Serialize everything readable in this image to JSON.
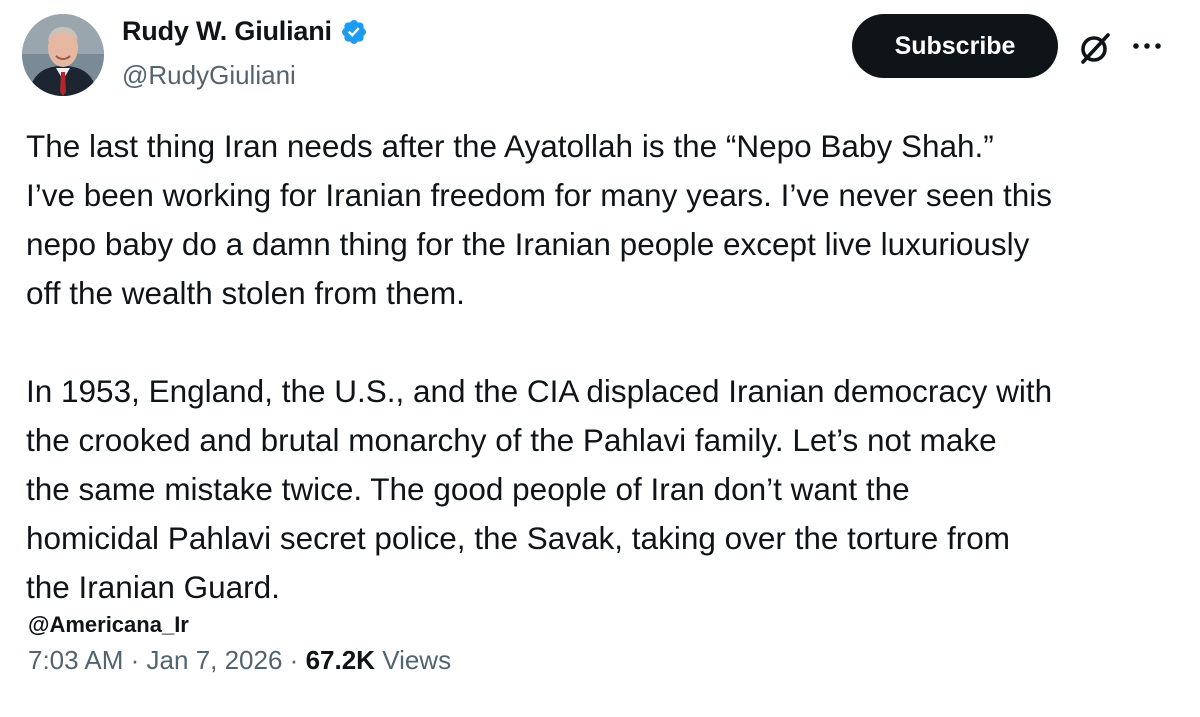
{
  "author": {
    "display_name": "Rudy W. Giuliani",
    "handle": "@RudyGiuliani",
    "avatar_icon": "profile-photo",
    "verified_icon": "verified-badge-icon",
    "verified_color": "#1d9bf0"
  },
  "actions": {
    "subscribe_label": "Subscribe",
    "grok_icon": "grok-icon",
    "more_icon": "more-icon"
  },
  "tweet": {
    "paragraphs": [
      {
        "lines": [
          "The last thing Iran needs after the Ayatollah is the “Nepo Baby Shah.”",
          "I’ve been working for Iranian freedom for many years. I’ve never seen this",
          "nepo baby do a damn thing for the Iranian people except live luxuriously",
          "off the wealth stolen from them."
        ]
      },
      {
        "lines": [
          "In 1953, England, the U.S., and the CIA displaced Iranian democracy with",
          "the crooked and brutal monarchy of the Pahlavi family. Let’s not make",
          "the same mistake twice. The good people of Iran don’t want the",
          "homicidal Pahlavi secret police, the Savak, taking over the torture from",
          "the Iranian Guard."
        ]
      }
    ]
  },
  "watermark": "@Americana_Ir",
  "meta": {
    "time": "7:03 AM",
    "separator": "·",
    "date": "Jan 7, 2026",
    "views_count": "67.2K",
    "views_label": "Views"
  },
  "colors": {
    "text": "#0f1419",
    "secondary": "#536471",
    "button_bg": "#0f1419",
    "button_text": "#ffffff"
  }
}
